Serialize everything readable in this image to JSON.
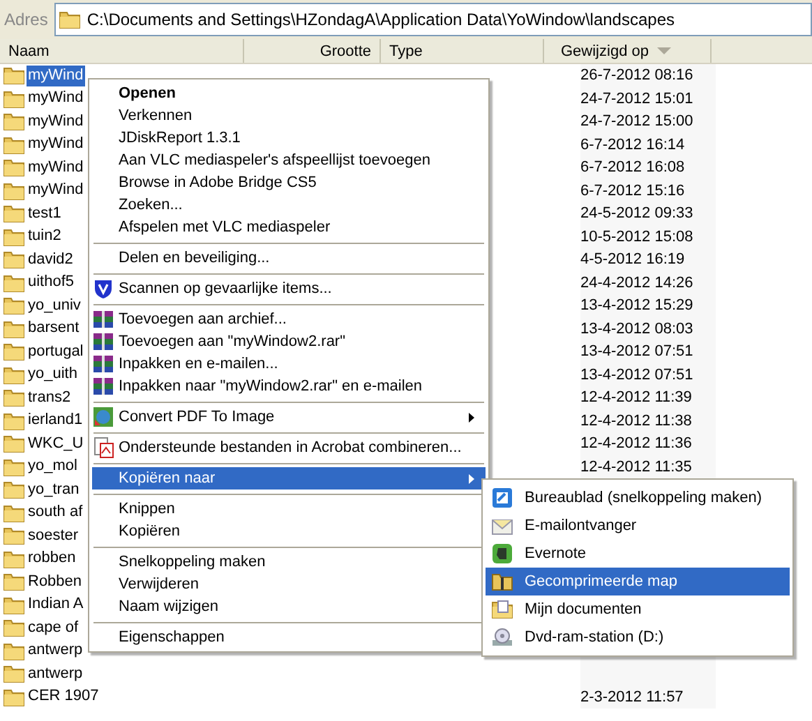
{
  "address_bar": {
    "label": "Adres",
    "path": "C:\\Documents and Settings\\HZondagA\\Application Data\\YoWindow\\landscapes"
  },
  "columns": [
    {
      "label": "Naam",
      "kind": "name"
    },
    {
      "label": "Grootte",
      "kind": "size"
    },
    {
      "label": "Type",
      "kind": "type"
    },
    {
      "label": "Gewijzigd op",
      "kind": "date",
      "sorted": true
    }
  ],
  "rows": [
    {
      "name": "myWind",
      "modified": "26-7-2012 08:16",
      "selected": true
    },
    {
      "name": "myWind",
      "modified": "24-7-2012 15:01",
      "selected": false
    },
    {
      "name": "myWind",
      "modified": "24-7-2012 15:00",
      "selected": false
    },
    {
      "name": "myWind",
      "modified": "6-7-2012 16:14",
      "selected": false
    },
    {
      "name": "myWind",
      "modified": "6-7-2012 16:08",
      "selected": false
    },
    {
      "name": "myWind",
      "modified": "6-7-2012 15:16",
      "selected": false
    },
    {
      "name": "test1",
      "modified": "24-5-2012 09:33",
      "selected": false
    },
    {
      "name": "tuin2",
      "modified": "10-5-2012 15:08",
      "selected": false
    },
    {
      "name": "david2",
      "modified": "4-5-2012 16:19",
      "selected": false
    },
    {
      "name": "uithof5",
      "modified": "24-4-2012 14:26",
      "selected": false
    },
    {
      "name": "yo_univ",
      "modified": "13-4-2012 15:29",
      "selected": false
    },
    {
      "name": "barsent",
      "modified": "13-4-2012 08:03",
      "selected": false
    },
    {
      "name": "portugal",
      "modified": "13-4-2012 07:51",
      "selected": false
    },
    {
      "name": "yo_uith",
      "modified": "13-4-2012 07:51",
      "selected": false
    },
    {
      "name": "trans2",
      "modified": "12-4-2012 11:39",
      "selected": false
    },
    {
      "name": "ierland1",
      "modified": "12-4-2012 11:38",
      "selected": false
    },
    {
      "name": "WKC_U",
      "modified": "12-4-2012 11:36",
      "selected": false
    },
    {
      "name": "yo_mol",
      "modified": "12-4-2012 11:35",
      "selected": false
    },
    {
      "name": "yo_tran",
      "selected": false
    },
    {
      "name": "south af",
      "selected": false
    },
    {
      "name": "soester",
      "selected": false
    },
    {
      "name": "robben",
      "selected": false
    },
    {
      "name": "Robben",
      "selected": false
    },
    {
      "name": "Indian A",
      "selected": false
    },
    {
      "name": "cape of",
      "selected": false
    },
    {
      "name": "antwerp",
      "selected": false
    },
    {
      "name": "antwerp",
      "selected": false
    },
    {
      "name": "CER 1907",
      "modified": "2-3-2012 11:57",
      "selected": false
    }
  ],
  "context_menu": {
    "items": [
      {
        "kind": "plain",
        "label": "Openen",
        "default": true,
        "selected": false
      },
      {
        "kind": "plain",
        "label": "Verkennen",
        "selected": false
      },
      {
        "kind": "plain",
        "label": "JDiskReport 1.3.1",
        "selected": false
      },
      {
        "kind": "plain",
        "label": "Aan VLC mediaspeler's afspeellijst toevoegen",
        "selected": false
      },
      {
        "kind": "plain",
        "label": "Browse in Adobe Bridge CS5",
        "selected": false
      },
      {
        "kind": "plain",
        "label": "Zoeken...",
        "selected": false
      },
      {
        "kind": "plain",
        "label": "Afspelen met VLC mediaspeler",
        "selected": false
      },
      {
        "kind": "separator"
      },
      {
        "kind": "plain",
        "label": "Delen en beveiliging...",
        "selected": false
      },
      {
        "kind": "separator"
      },
      {
        "kind": "scan",
        "label": "Scannen op gevaarlijke items...",
        "selected": false
      },
      {
        "kind": "separator"
      },
      {
        "kind": "archive",
        "label": "Toevoegen aan archief...",
        "selected": false
      },
      {
        "kind": "archive",
        "label": "Toevoegen aan \"myWindow2.rar\"",
        "selected": false
      },
      {
        "kind": "archive",
        "label": "Inpakken en e-mailen...",
        "selected": false
      },
      {
        "kind": "archive",
        "label": "Inpakken naar \"myWindow2.rar\" en e-mailen",
        "selected": false
      },
      {
        "kind": "separator"
      },
      {
        "kind": "convert",
        "label": "Convert PDF To Image",
        "submenu": true,
        "selected": false
      },
      {
        "kind": "separator"
      },
      {
        "kind": "combine",
        "label": "Ondersteunde bestanden in Acrobat combineren...",
        "selected": false
      },
      {
        "kind": "separator"
      },
      {
        "kind": "plain",
        "label": "Kopiëren naar",
        "submenu": true,
        "selected": true
      },
      {
        "kind": "separator"
      },
      {
        "kind": "plain",
        "label": "Knippen",
        "selected": false
      },
      {
        "kind": "plain",
        "label": "Kopiëren",
        "selected": false
      },
      {
        "kind": "separator"
      },
      {
        "kind": "plain",
        "label": "Snelkoppeling maken",
        "selected": false
      },
      {
        "kind": "plain",
        "label": "Verwijderen",
        "selected": false
      },
      {
        "kind": "plain",
        "label": "Naam wijzigen",
        "selected": false
      },
      {
        "kind": "separator"
      },
      {
        "kind": "plain",
        "label": "Eigenschappen",
        "selected": false
      }
    ]
  },
  "submenu": {
    "items": [
      {
        "kind": "desktop",
        "label": "Bureaublad (snelkoppeling maken)",
        "selected": false
      },
      {
        "kind": "mail",
        "label": "E-mailontvanger",
        "selected": false
      },
      {
        "kind": "evernote",
        "label": "Evernote",
        "selected": false
      },
      {
        "kind": "zip",
        "label": "Gecomprimeerde map",
        "selected": true
      },
      {
        "kind": "documents",
        "label": "Mijn documenten",
        "selected": false
      },
      {
        "kind": "drive",
        "label": "Dvd-ram-station (D:)",
        "selected": false
      }
    ]
  }
}
